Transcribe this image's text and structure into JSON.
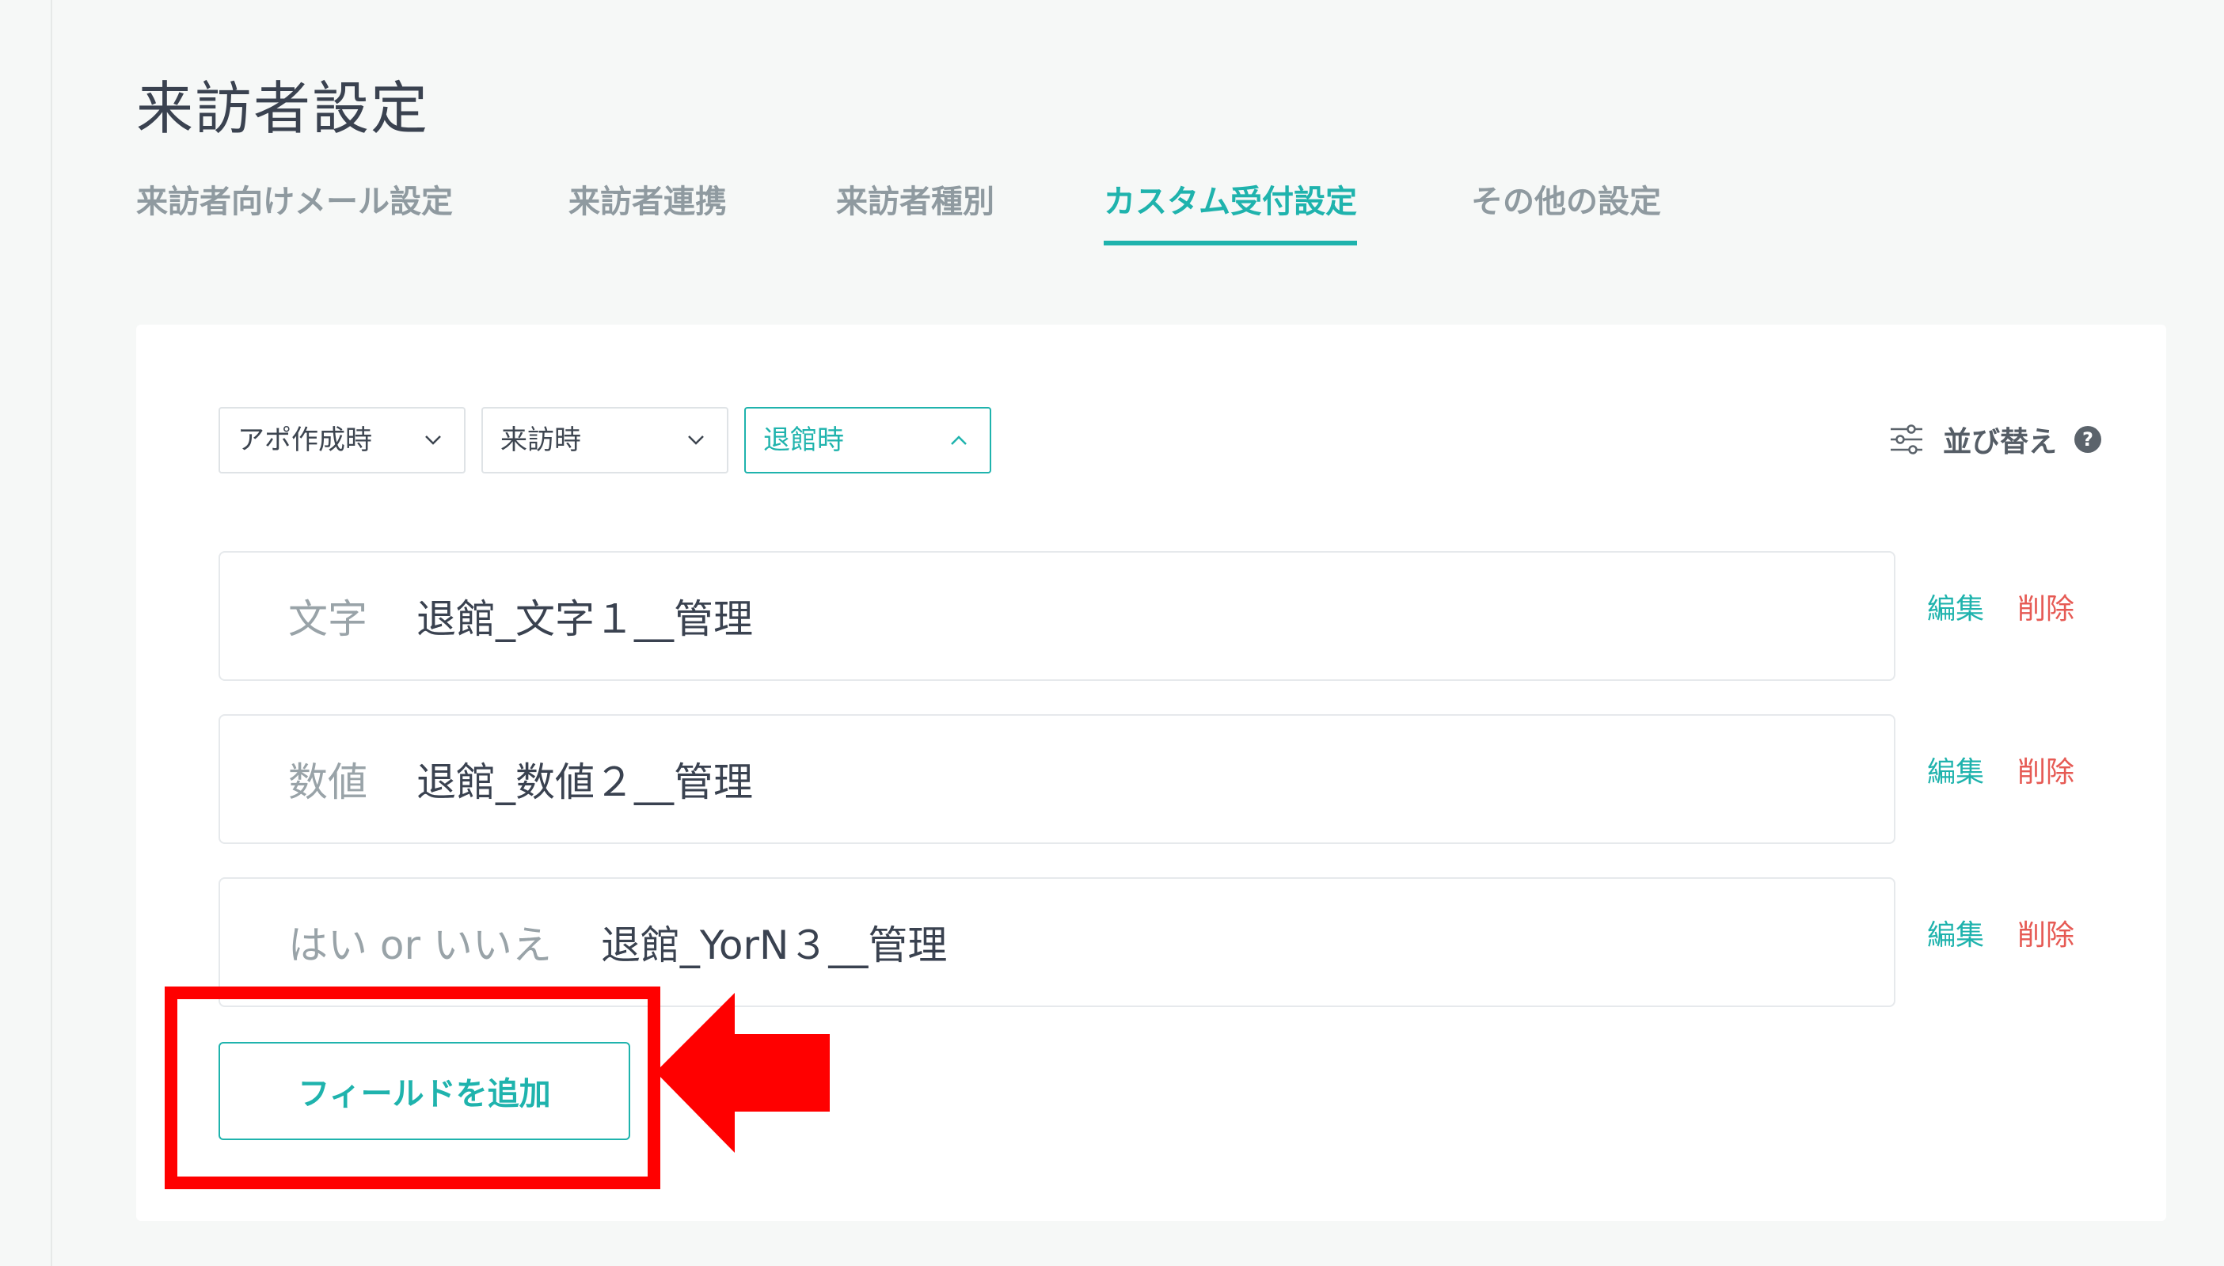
{
  "page": {
    "title": "来訪者設定"
  },
  "tabs": [
    {
      "label": "来訪者向けメール設定",
      "active": false
    },
    {
      "label": "来訪者連携",
      "active": false
    },
    {
      "label": "来訪者種別",
      "active": false
    },
    {
      "label": "カスタム受付設定",
      "active": true
    },
    {
      "label": "その他の設定",
      "active": false
    }
  ],
  "filters": [
    {
      "label": "アポ作成時",
      "icon": "chevron-down-icon",
      "open": false
    },
    {
      "label": "来訪時",
      "icon": "chevron-down-icon",
      "open": false
    },
    {
      "label": "退館時",
      "icon": "chevron-up-icon",
      "open": true
    }
  ],
  "sort": {
    "label": "並び替え",
    "icon": "sliders-icon",
    "help_icon": "question-circle-icon",
    "help_glyph": "?"
  },
  "fields": [
    {
      "type": "文字",
      "name": "退館_文字１__管理",
      "edit": "編集",
      "delete": "削除"
    },
    {
      "type": "数値",
      "name": "退館_数値２__管理",
      "edit": "編集",
      "delete": "削除"
    },
    {
      "type": "はい or いいえ",
      "name": "退館_YorN３__管理",
      "edit": "編集",
      "delete": "削除"
    }
  ],
  "add_field": {
    "label": "フィールドを追加"
  },
  "colors": {
    "accent": "#1fb3ad",
    "danger": "#e65a54",
    "annotation": "#ff0000"
  }
}
